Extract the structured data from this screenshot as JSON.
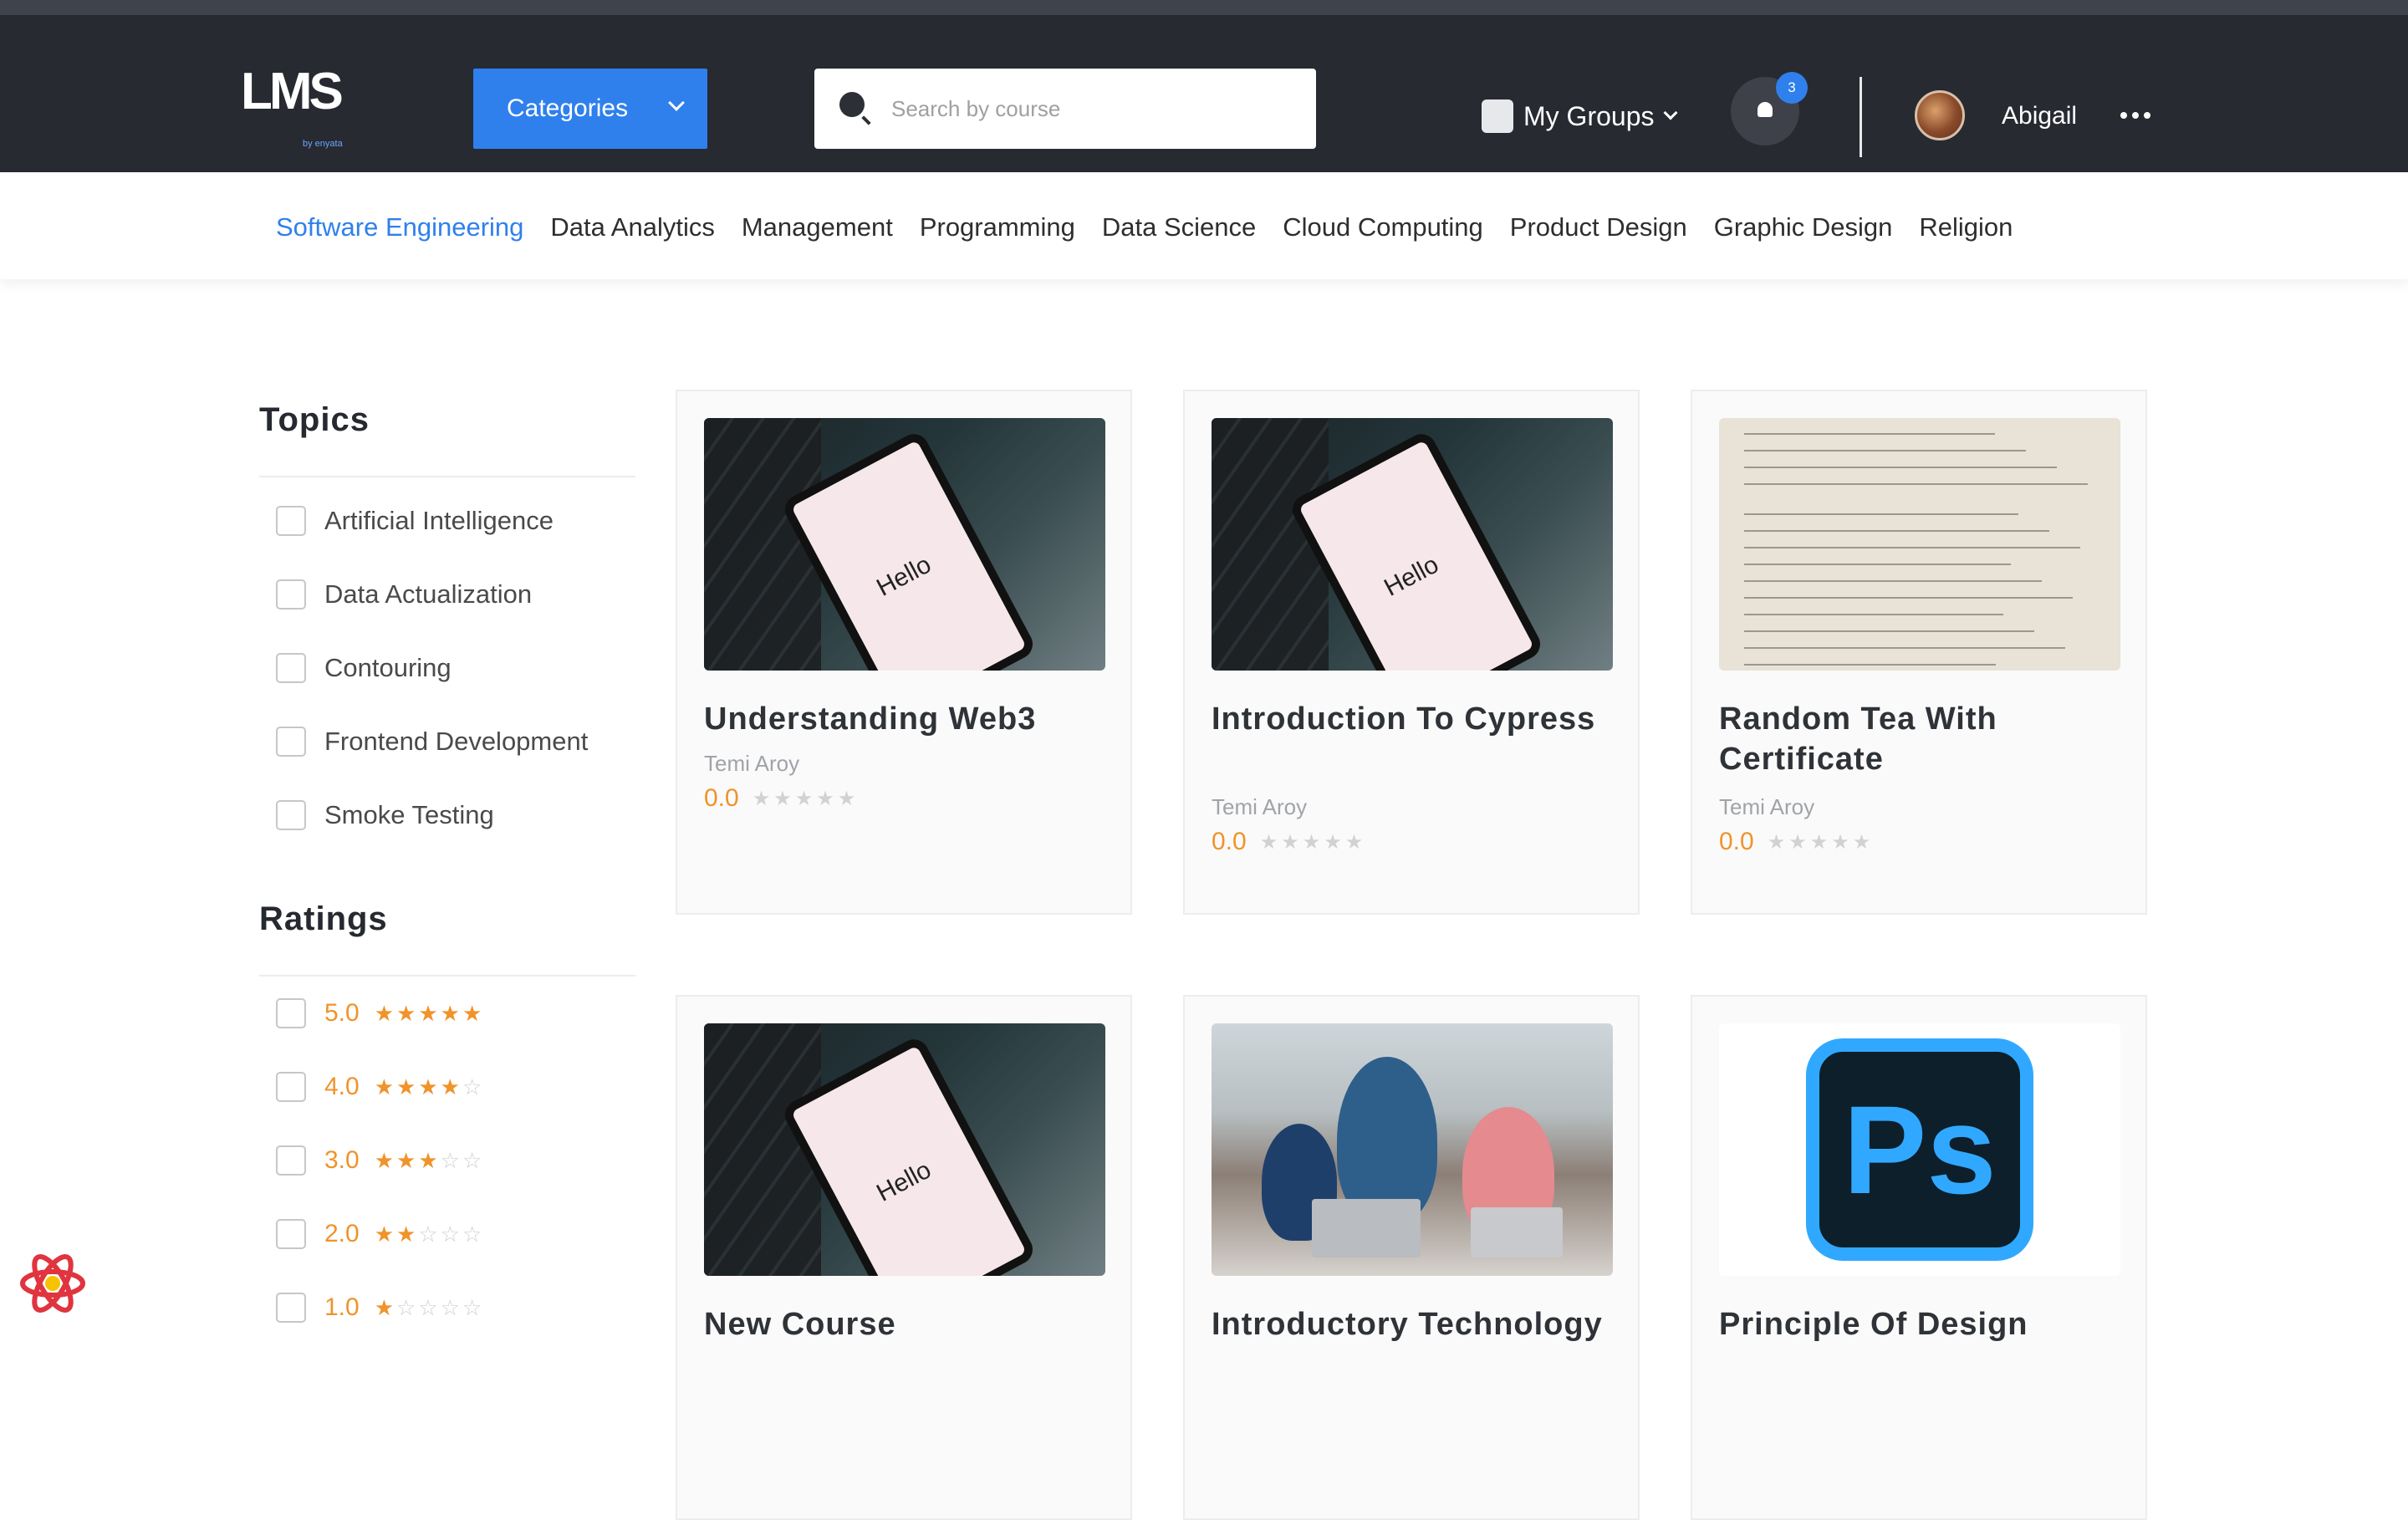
{
  "header": {
    "logo_text": "LMS",
    "logo_sub": "by enyata",
    "categories_label": "Categories",
    "search_placeholder": "Search by course",
    "groups_label": "My Groups",
    "notification_count": "3",
    "user_name": "Abigail"
  },
  "nav": {
    "items": [
      "Software Engineering",
      "Data Analytics",
      "Management",
      "Programming",
      "Data Science",
      "Cloud Computing",
      "Product Design",
      "Graphic Design",
      "Religion"
    ],
    "active": "Software Engineering"
  },
  "sidebar": {
    "topics_title": "Topics",
    "topics": [
      "Artificial Intelligence",
      "Data Actualization",
      "Contouring",
      "Frontend Development",
      "Smoke Testing"
    ],
    "ratings_title": "Ratings",
    "ratings": [
      {
        "value": "5.0",
        "stars": 5
      },
      {
        "value": "4.0",
        "stars": 4
      },
      {
        "value": "3.0",
        "stars": 3
      },
      {
        "value": "2.0",
        "stars": 2
      },
      {
        "value": "1.0",
        "stars": 1
      }
    ]
  },
  "courses": [
    {
      "title": "Understanding Web3",
      "author": "Temi Aroy",
      "rating": "0.0",
      "image": "phone-hello",
      "hello": "Hello"
    },
    {
      "title": "Introduction To Cypress",
      "author": "Temi Aroy",
      "rating": "0.0",
      "image": "phone-hello",
      "hello": "Hello"
    },
    {
      "title": "Random Tea With Certificate",
      "author": "Temi Aroy",
      "rating": "0.0",
      "image": "handwritten-note"
    },
    {
      "title": "New Course",
      "author": "",
      "rating": "",
      "image": "phone-hello",
      "hello": "Hello"
    },
    {
      "title": "Introductory Technology",
      "author": "",
      "rating": "",
      "image": "classroom"
    },
    {
      "title": "Principle Of Design",
      "author": "",
      "rating": "",
      "image": "photoshop-logo",
      "logo": "Ps"
    }
  ],
  "colors": {
    "accent": "#2f80ed",
    "topbar": "#272a31",
    "rating": "#f0932b"
  }
}
